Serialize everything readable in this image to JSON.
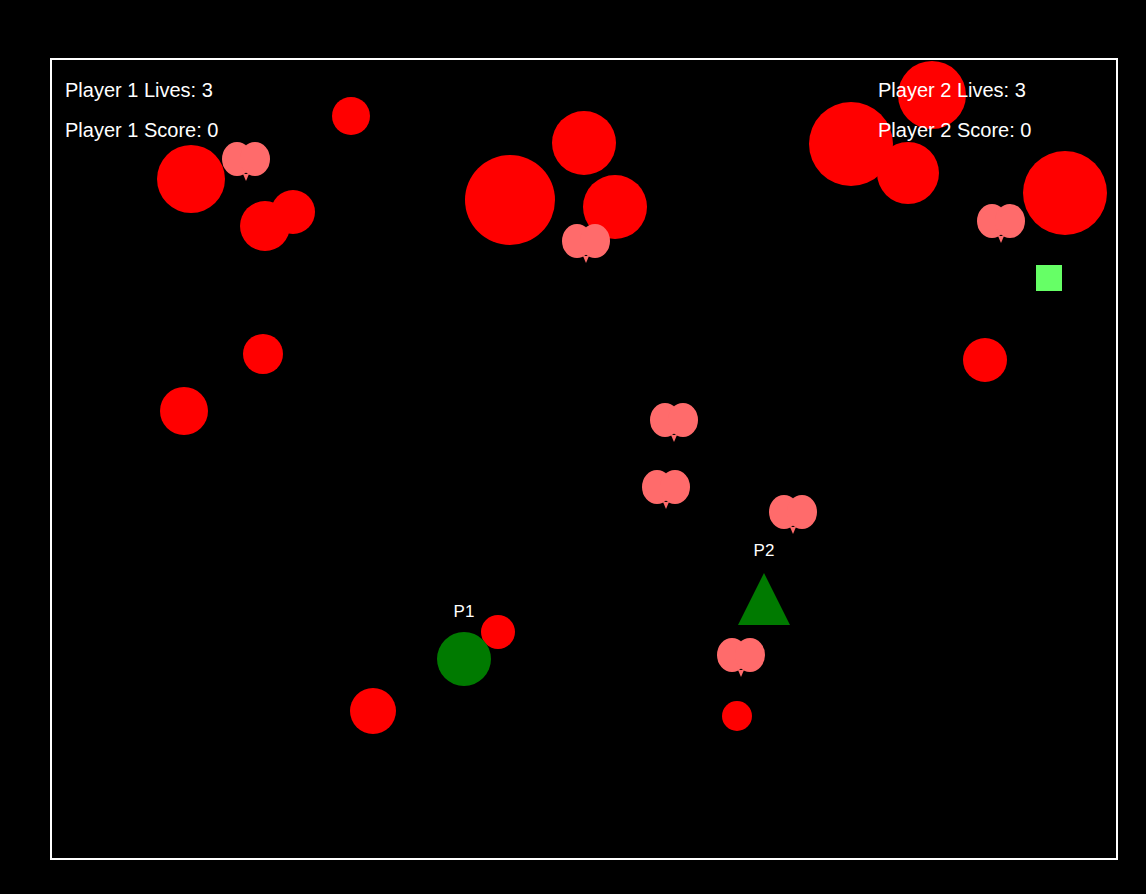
{
  "hud": {
    "left": [
      "Player 1 Lives: 3",
      "Player 1 Score: 0"
    ],
    "right": [
      "Player 2 Lives: 3",
      "Player 2 Score: 0"
    ]
  },
  "players": [
    {
      "tag": "P1",
      "kind": "circle",
      "color": "#007a00"
    },
    {
      "tag": "P2",
      "kind": "triangle",
      "color": "#007a00"
    }
  ]
}
